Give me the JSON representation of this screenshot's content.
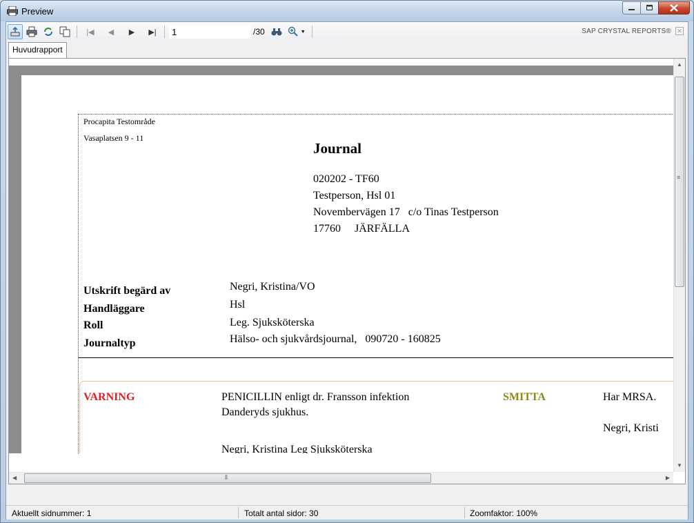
{
  "window": {
    "title": "Preview"
  },
  "toolbar": {
    "page_value": "1",
    "page_total": "/30",
    "brand": "SAP CRYSTAL REPORTS®",
    "icons": [
      "export-icon",
      "print-icon",
      "refresh-icon",
      "copy-icon",
      "first-page-icon",
      "prev-page-icon",
      "next-page-icon",
      "last-page-icon",
      "find-icon",
      "zoom-icon"
    ]
  },
  "tabs": [
    {
      "label": "Huvudrapport"
    }
  ],
  "report": {
    "org_name": "Procapita Testområde",
    "org_address": "Vasaplatsen 9 - 11",
    "heading": "Journal",
    "patient": {
      "id": "020202 - TF60",
      "name": "Testperson, Hsl 01",
      "street": "Novembervägen 17   c/o Tinas Testperson",
      "postal": "17760     JÄRFÄLLA"
    },
    "fields": [
      {
        "label": "Utskrift begärd av",
        "value": "Negri, Kristina/VO"
      },
      {
        "label": "Handläggare",
        "value": "Hsl"
      },
      {
        "label": "Roll",
        "value": "Leg. Sjuksköterska"
      },
      {
        "label": "Journaltyp",
        "value": "Hälso- och sjukvårdsjournal,   090720 - 160825"
      }
    ],
    "warning": {
      "label": "VARNING",
      "text_line1": "PENICILLIN enligt dr. Fransson infektion",
      "text_line2": "Danderyds sjukhus.",
      "signed_by": "Negri, Kristina Leg Sjuksköterska",
      "label_color": "#e8191f"
    },
    "infection": {
      "label": "SMITTA",
      "text": "Har MRSA.",
      "signed_by": "Negri, Kristi",
      "label_color": "#8a8a12"
    }
  },
  "status": {
    "current_page": "Aktuellt sidnummer: 1",
    "total_pages": "Totalt antal sidor: 30",
    "zoom": "Zoomfaktor: 100%"
  }
}
